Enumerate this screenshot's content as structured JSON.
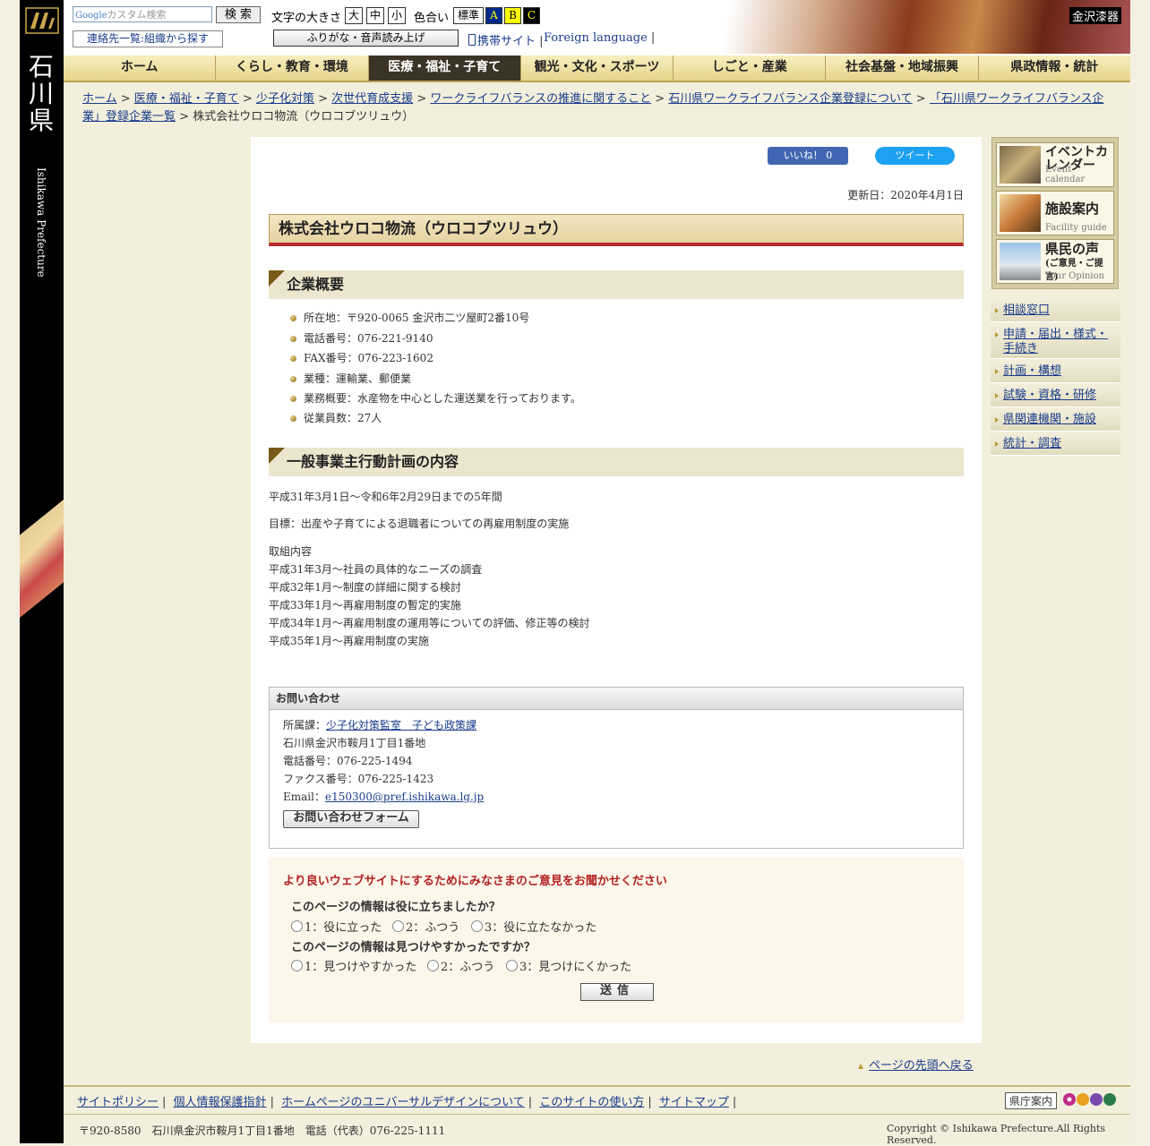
{
  "header": {
    "search_placeholder": "カスタム検索",
    "search_brand": "Google",
    "search_button": "検 索",
    "font_size_label": "文字の大きさ",
    "font_sizes": [
      "大",
      "中",
      "小"
    ],
    "color_label": "色合い",
    "color_options": [
      "標準",
      "A",
      "B",
      "C"
    ],
    "contact_list_button": "連絡先一覧:組織から探す",
    "furigana_button": "ふりがな・音声読み上げ",
    "mobile_link": "携帯サイト",
    "foreign_link": "Foreign language",
    "banner_label": "金沢漆器"
  },
  "left_bar": {
    "kanji": "石川県",
    "english": "Ishikawa Prefecture"
  },
  "nav": {
    "items": [
      "ホーム",
      "くらし・教育・環境",
      "医療・福祉・子育て",
      "観光・文化・スポーツ",
      "しごと・産業",
      "社会基盤・地域振興",
      "県政情報・統計"
    ]
  },
  "breadcrumb": {
    "links": [
      "ホーム",
      "医療・福祉・子育て",
      "少子化対策",
      "次世代育成支援",
      "ワークライフバランスの推進に関すること",
      "石川県ワークライフバランス企業登録について",
      "「石川県ワークライフバランス企業」登録企業一覧"
    ],
    "current": "株式会社ウロコ物流（ウロコブツリュウ）"
  },
  "social": {
    "like": "いいね！ 0",
    "tweet": "ツイート"
  },
  "main": {
    "updated": "更新日：2020年4月1日",
    "title": "株式会社ウロコ物流（ウロコブツリュウ）",
    "section1_title": "企業概要",
    "overview": [
      "所在地：〒920-0065 金沢市二ツ屋町2番10号",
      "電話番号：076-221-9140",
      "FAX番号：076-223-1602",
      "業種：運輸業、郵便業",
      "業務概要：水産物を中心とした運送業を行っております。",
      "従業員数：27人"
    ],
    "section2_title": "一般事業主行動計画の内容",
    "period": "平成31年3月1日～令和6年2月29日までの5年間",
    "goal": "目標：出産や子育てによる退職者についての再雇用制度の実施",
    "actions_title": "取組内容",
    "actions": [
      "平成31年3月～社員の具体的なニーズの調査",
      "平成32年1月～制度の詳細に関する検討",
      "平成33年1月～再雇用制度の暫定的実施",
      "平成34年1月～再雇用制度の運用等についての評価、修正等の検討",
      "平成35年1月～再雇用制度の実施"
    ]
  },
  "contact": {
    "heading": "お問い合わせ",
    "dept_label": "所属課：",
    "dept_link": "少子化対策監室　子ども政策課",
    "address": "石川県金沢市鞍月1丁目1番地",
    "phone": "電話番号：076-225-1494",
    "fax": "ファクス番号：076-225-1423",
    "email_label": "Email：",
    "email": "e150300@pref.ishikawa.lg.jp",
    "form_button": "お問い合わせフォーム"
  },
  "survey": {
    "title": "より良いウェブサイトにするためにみなさまのご意見をお聞かせください",
    "q1": "このページの情報は役に立ちましたか？",
    "q1_options": [
      "1：役に立った",
      "2：ふつう",
      "3：役に立たなかった"
    ],
    "q2": "このページの情報は見つけやすかったですか？",
    "q2_options": [
      "1：見つけやすかった",
      "2：ふつう",
      "3：見つけにくかった"
    ],
    "submit": "送信"
  },
  "sidebar": {
    "banners": [
      {
        "title": "イベントカレンダー",
        "sub": "Event calendar"
      },
      {
        "title": "施設案内",
        "sub": "Facility guide"
      },
      {
        "title": "県民の声",
        "title2": "(ご意見・ご提言)",
        "sub": "Your Opinion"
      }
    ],
    "links": [
      "相談窓口",
      "申請・届出・様式・手続き",
      "計画・構想",
      "試験・資格・研修",
      "県関連機関・施設",
      "統計・調査"
    ]
  },
  "footer": {
    "page_top": "ページの先頭へ戻る",
    "links": [
      "サイトポリシー",
      "個人情報保護指針",
      "ホームページのユニバーサルデザインについて",
      "このサイトの使い方",
      "サイトマップ"
    ],
    "kencho": "県庁案内",
    "address": "〒920-8580　石川県金沢市鞍月1丁目1番地　電話（代表）076-225-1111",
    "copyright": "Copyright © Ishikawa Prefecture.All Rights Reserved."
  }
}
